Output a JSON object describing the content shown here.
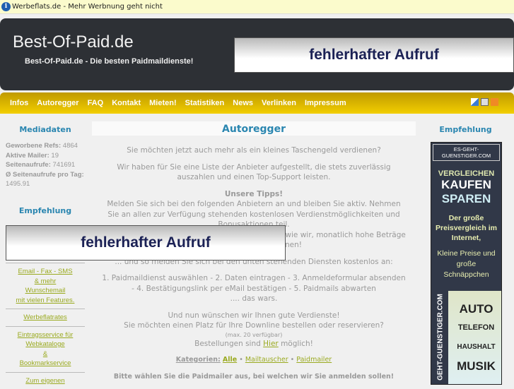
{
  "infobar": {
    "text": "Werbeflats.de - Mehr Werbnung geht nicht"
  },
  "header": {
    "logo": "Best-Of-Paid.de",
    "slogan": "Best-Of-Paid.de - Die besten Paidmaildienste!",
    "ad_text": "fehlerhafter Aufruf"
  },
  "nav": {
    "items": [
      "Infos",
      "Autoregger",
      "FAQ",
      "Kontakt",
      "Mieten!",
      "Statistiken",
      "News",
      "Verlinken",
      "Impressum"
    ]
  },
  "left": {
    "mediadaten_title": "Mediadaten",
    "stats": [
      {
        "label": "Geworbene Refs:",
        "value": "4864"
      },
      {
        "label": "Aktive Mailer:",
        "value": "19"
      },
      {
        "label": "Seitenaufrufe:",
        "value": "741691"
      },
      {
        "label": "Ø Seitenaufrufe pro Tag:",
        "value": "1495.91"
      }
    ],
    "empfehlung_title": "Empfehlung",
    "ad_text": "fehlerhafter Aufruf",
    "links": [
      "Email - Fax - SMS",
      "& mehr",
      "Wunschemail",
      "mit vielen Features.",
      "Werbeflatrates",
      "Eintragsservice für",
      "Webkataloge",
      "&",
      "Bookmarkservice",
      "Zum eigenen"
    ]
  },
  "main": {
    "title": "Autoregger",
    "p1": "Sie möchten jetzt auch mehr als ein kleines Taschengeld verdienen?",
    "p2": "Wir haben für Sie eine Liste der Anbieter aufgestellt, die stets zuverlässig auszahlen und einen Top-Support leisten.",
    "tips_title": "Unsere Tipps!",
    "tips1": "Melden Sie sich bei den folgenden Anbietern an und bleiben Sie aktiv. Nehmen Sie an allen zur Verfügung stehenden kostenlosen Verdienstmöglichkeiten und Bonusaktionen teil.",
    "tips2": "Werben Sie außerdem Refs damit Sie sich genau wie wir, monatlich hohe Beträge auszahlen lassen können!",
    "p3": "... und so melden Sie sich bei den unten stehenden Diensten kostenlos an:",
    "steps": "1. Paidmaildienst auswählen - 2. Daten eintragen - 3. Anmeldeformular absenden - 4. Bestätigungslink per eMail bestätigen - 5. Paidmails abwarten",
    "steps_end": ".... das wars.",
    "wish": "Und nun wünschen wir Ihnen gute Verdienste!",
    "downline": "Sie möchten einen Platz für Ihre Downline bestellen oder reservieren?",
    "max": "(max. 20 verfügbar)",
    "order_pre": "Bestellungen sind",
    "order_link": "Hier",
    "order_post": "möglich!",
    "cat_label": "Kategorien:",
    "cat_all": "Alle",
    "cat_mt": "Mailtauscher",
    "cat_pm": "Paidmailer",
    "choose": "Bitte wählen Sie die Paidmailer aus, bei welchen wir Sie anmelden sollen!"
  },
  "right": {
    "title": "Empfehlung",
    "banner": {
      "domain": "ES-GEHT-GUENSTIGER.COM",
      "l1": "VERGLEICHEN",
      "l2": "KAUFEN",
      "l3": "SPAREN",
      "t1": "Der große Preisvergleich im Internet,",
      "t2": "Kleine Preise und große Schnäppchen",
      "side": "GEHT-GUENSTIGER.COM",
      "w1": "AUTO",
      "w2": "TELEFON",
      "w3": "HAUSHALT",
      "w4": "MUSIK"
    }
  }
}
